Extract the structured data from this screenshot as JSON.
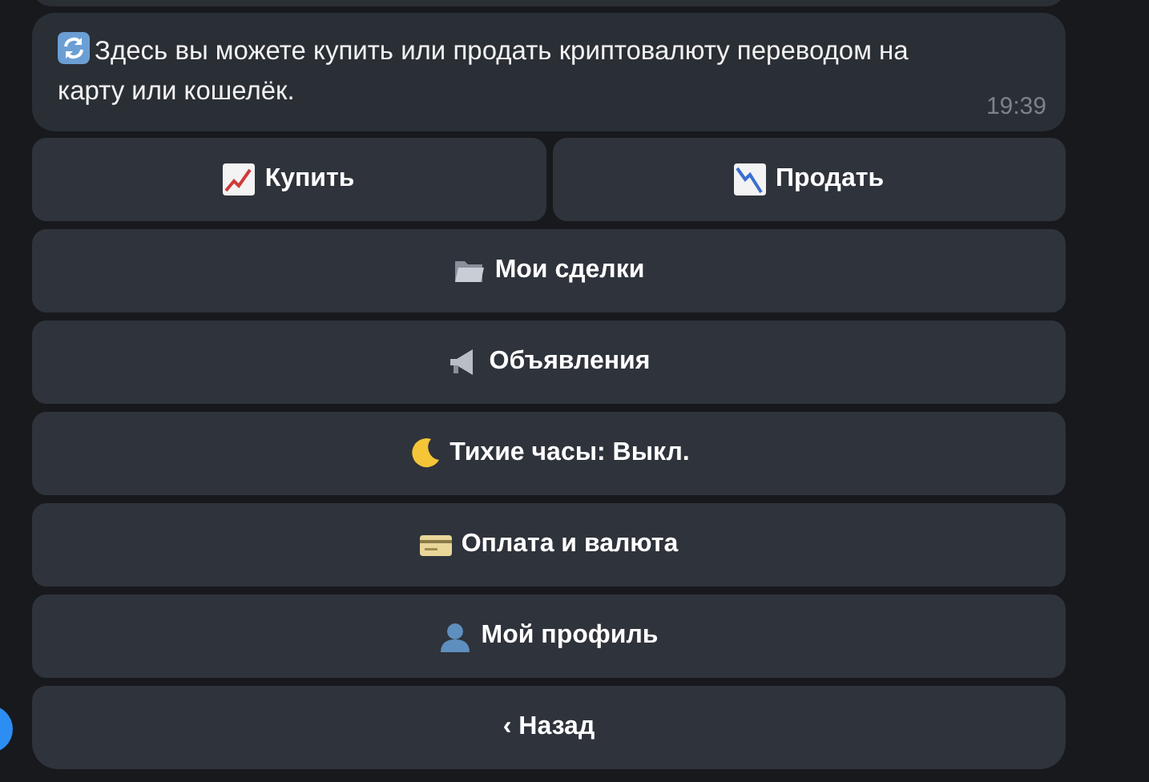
{
  "message": {
    "text": "Здесь вы можете купить или продать криптовалюту переводом на карту или кошелёк.",
    "time": "19:39"
  },
  "keyboard": [
    [
      "Купить",
      "Продать"
    ],
    [
      "Мои сделки"
    ],
    [
      "Объявления"
    ],
    [
      "Тихие часы: Выкл."
    ],
    [
      "Оплата и валюта"
    ],
    [
      "Мой профиль"
    ],
    [
      "‹ Назад"
    ]
  ]
}
